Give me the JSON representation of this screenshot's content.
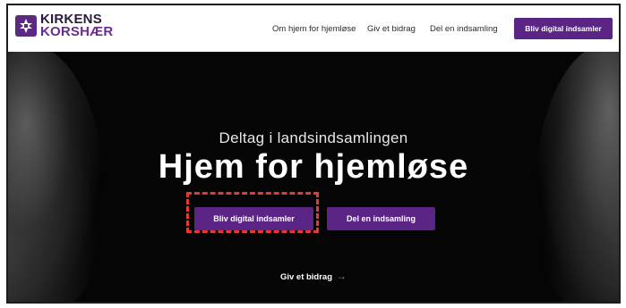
{
  "header": {
    "logo": {
      "line1": "KIRKENS",
      "line2": "KORSHÆR",
      "icon": "cross-icon"
    },
    "nav": [
      {
        "label": "Om hjem for hjemløse"
      },
      {
        "label": "Giv et bidrag"
      },
      {
        "label": "Del en indsamling"
      }
    ],
    "cta_label": "Bliv digital indsamler"
  },
  "hero": {
    "subtitle": "Deltag i landsindsamlingen",
    "title": "Hjem for hjemløse",
    "primary_button": "Bliv digital indsamler",
    "secondary_button": "Del en indsamling",
    "give_link": "Giv et bidrag",
    "give_arrow": "→"
  },
  "colors": {
    "brand_purple": "#5b2585",
    "highlight_red": "#e53935",
    "hero_background": "#050505"
  }
}
